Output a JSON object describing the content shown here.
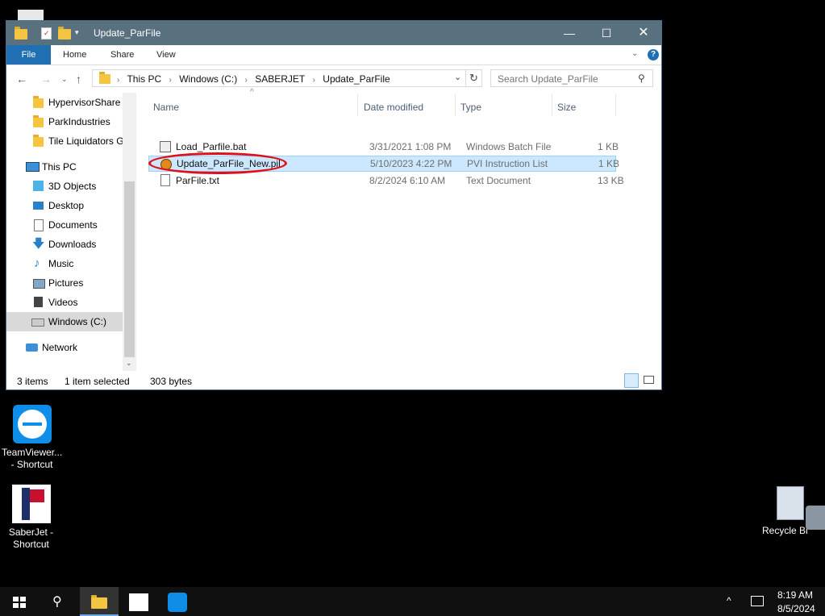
{
  "window": {
    "title": "Update_ParFile",
    "ribbon_tabs": [
      "File",
      "Home",
      "Share",
      "View"
    ],
    "breadcrumb": [
      "This PC",
      "Windows (C:)",
      "SABERJET",
      "Update_ParFile"
    ],
    "search_placeholder": "Search Update_ParFile"
  },
  "nav_pane": {
    "items": [
      {
        "label": "HypervisorShare",
        "icon": "folder-icon"
      },
      {
        "label": "ParkIndustries",
        "icon": "folder-icon"
      },
      {
        "label": "Tile Liquidators G",
        "icon": "folder-icon"
      },
      {
        "label": "This PC",
        "icon": "computer-icon"
      },
      {
        "label": "3D Objects",
        "icon": "cube-icon"
      },
      {
        "label": "Desktop",
        "icon": "desktop-icon"
      },
      {
        "label": "Documents",
        "icon": "document-icon"
      },
      {
        "label": "Downloads",
        "icon": "download-icon"
      },
      {
        "label": "Music",
        "icon": "music-icon"
      },
      {
        "label": "Pictures",
        "icon": "pictures-icon"
      },
      {
        "label": "Videos",
        "icon": "video-icon"
      },
      {
        "label": "Windows (C:)",
        "icon": "drive-icon"
      },
      {
        "label": "Network",
        "icon": "network-icon"
      }
    ]
  },
  "file_list": {
    "columns": [
      "Name",
      "Date modified",
      "Type",
      "Size"
    ],
    "rows": [
      {
        "name": "Load_Parfile.bat",
        "date": "3/31/2021 1:08 PM",
        "type": "Windows Batch File",
        "size": "1 KB"
      },
      {
        "name": "Update_ParFile_New.pil",
        "date": "5/10/2023 4:22 PM",
        "type": "PVI Instruction List",
        "size": "1 KB"
      },
      {
        "name": "ParFile.txt",
        "date": "8/2/2024 6:10 AM",
        "type": "Text Document",
        "size": "13 KB"
      }
    ]
  },
  "status_bar": {
    "item_count": "3 items",
    "selection": "1 item selected",
    "selection_size": "303 bytes"
  },
  "desktop": {
    "icons": [
      {
        "label_line1": "TeamViewer...",
        "label_line2": "- Shortcut"
      },
      {
        "label_line1": "SaberJet -",
        "label_line2": "Shortcut"
      },
      {
        "label_line1": "Recycle Bi",
        "label_line2": ""
      }
    ]
  },
  "taskbar": {
    "time": "8:19 AM",
    "date": "8/5/2024"
  },
  "colors": {
    "accent": "#1f6fb2",
    "titlebar": "#59717f",
    "selection": "#cce8ff",
    "annotation": "#e0101a"
  }
}
